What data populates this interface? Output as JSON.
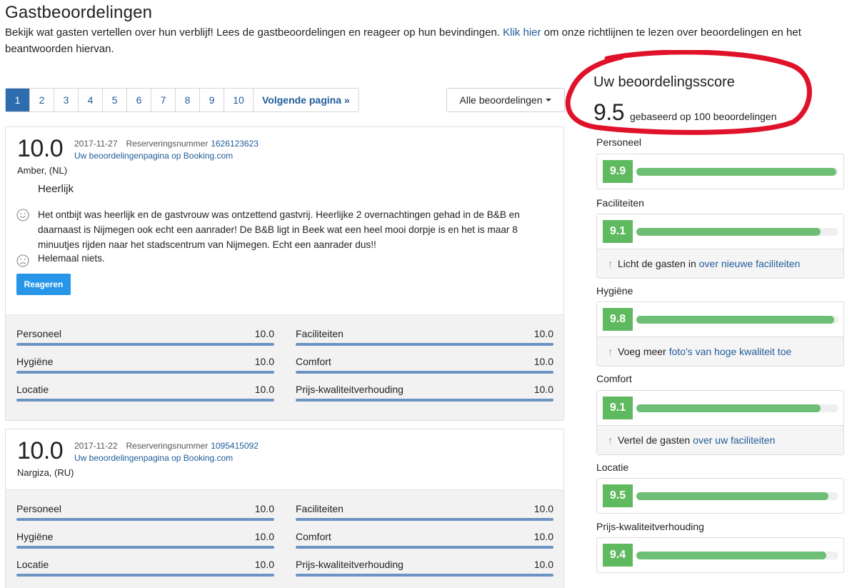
{
  "page": {
    "title": "Gastbeoordelingen",
    "intro_text": "Bekijk wat gasten vertellen over hun verblijf! Lees de gastbeoordelingen en reageer op hun bevindingen. ",
    "intro_link": "Klik hier",
    "intro_text2": " om onze richtlijnen te lezen over beoordelingen en het beantwoorden hiervan."
  },
  "pagination": {
    "pages": [
      "1",
      "2",
      "3",
      "4",
      "5",
      "6",
      "7",
      "8",
      "9",
      "10"
    ],
    "active": "1",
    "next_label": "Volgende pagina »"
  },
  "filter": {
    "label": "Alle beoordelingen"
  },
  "reviews": [
    {
      "score": "10.0",
      "date": "2017-11-27",
      "reservation_label": "Reserveringsnummer",
      "reservation_number": "1626123623",
      "page_link": "Uw beoordelingenpagina op Booking.com",
      "guest": "Amber, (NL)",
      "title": "Heerlijk",
      "positive": "Het ontbijt was heerlijk en de gastvrouw was ontzettend gastvrij. Heerlijke 2 overnachtingen gehad in de B&B en daarnaast is Nijmegen ook echt een aanrader! De B&B ligt in Beek wat een heel mooi dorpje is en het is maar 8 minuutjes rijden naar het stadscentrum van Nijmegen. Echt een aanrader dus!!",
      "negative": "Helemaal niets.",
      "reply_button": "Reageren",
      "subscores": [
        {
          "name": "Personeel",
          "value": "10.0"
        },
        {
          "name": "Faciliteiten",
          "value": "10.0"
        },
        {
          "name": "Hygiëne",
          "value": "10.0"
        },
        {
          "name": "Comfort",
          "value": "10.0"
        },
        {
          "name": "Locatie",
          "value": "10.0"
        },
        {
          "name": "Prijs-kwaliteitverhouding",
          "value": "10.0"
        }
      ]
    },
    {
      "score": "10.0",
      "date": "2017-11-22",
      "reservation_label": "Reserveringsnummer",
      "reservation_number": "1095415092",
      "page_link": "Uw beoordelingenpagina op Booking.com",
      "guest": "Nargiza, (RU)",
      "subscores": [
        {
          "name": "Personeel",
          "value": "10.0"
        },
        {
          "name": "Faciliteiten",
          "value": "10.0"
        },
        {
          "name": "Hygiëne",
          "value": "10.0"
        },
        {
          "name": "Comfort",
          "value": "10.0"
        },
        {
          "name": "Locatie",
          "value": "10.0"
        },
        {
          "name": "Prijs-kwaliteitverhouding",
          "value": "10.0"
        }
      ]
    }
  ],
  "summary": {
    "title": "Uw beoordelingsscore",
    "score": "9.5",
    "based_on": "gebaseerd op 100 beoordelingen",
    "categories": [
      {
        "name": "Personeel",
        "score": "9.9",
        "fraction": 0.99
      },
      {
        "name": "Faciliteiten",
        "score": "9.1",
        "fraction": 0.91,
        "tip_prefix": "Licht de gasten in",
        "tip_link": "over nieuwe faciliteiten"
      },
      {
        "name": "Hygiëne",
        "score": "9.8",
        "fraction": 0.98,
        "tip_prefix": "Voeg meer",
        "tip_link": "foto's van hoge kwaliteit toe"
      },
      {
        "name": "Comfort",
        "score": "9.1",
        "fraction": 0.91,
        "tip_prefix": "Vertel de gasten",
        "tip_link": "over uw faciliteiten"
      },
      {
        "name": "Locatie",
        "score": "9.5",
        "fraction": 0.95
      },
      {
        "name": "Prijs-kwaliteitverhouding",
        "score": "9.4",
        "fraction": 0.94
      }
    ]
  },
  "colors": {
    "brand_blue": "#2d6dae",
    "button_blue": "#2896e8",
    "score_green": "#5fb95f",
    "highlight_red": "#e0122a"
  }
}
